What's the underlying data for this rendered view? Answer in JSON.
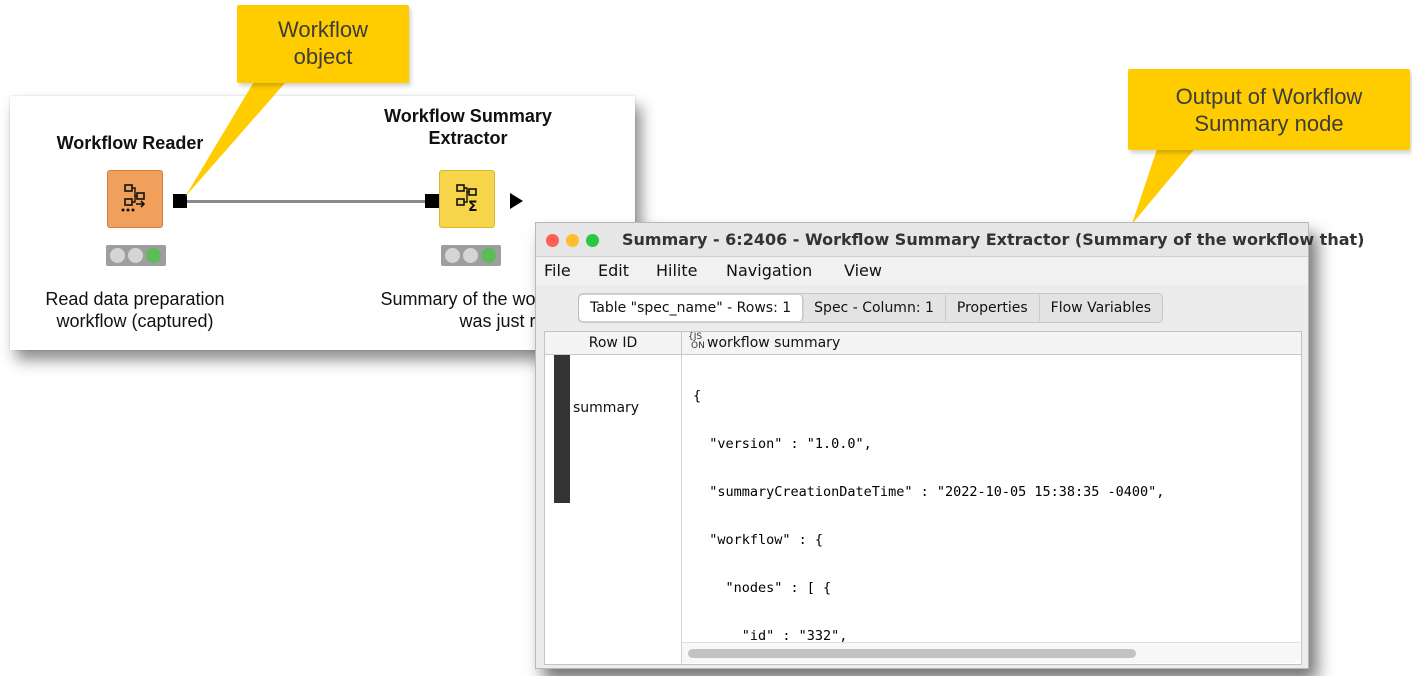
{
  "callouts": {
    "workflow_object": [
      "Workflow",
      "object"
    ],
    "output": [
      "Output of Workflow",
      "Summary node"
    ]
  },
  "workflow": {
    "reader": {
      "title": "Workflow Reader",
      "description": [
        "Read data preparation",
        "workflow (captured)"
      ]
    },
    "extractor": {
      "title": [
        "Workflow Summary",
        "Extractor"
      ],
      "description": [
        "Summary of the workfl",
        "was just read"
      ]
    }
  },
  "window": {
    "title": "Summary - 6:2406 - Workflow Summary Extractor (Summary of the workflow that)",
    "menu": [
      "File",
      "Edit",
      "Hilite",
      "Navigation",
      "View"
    ],
    "tabs": [
      {
        "label": "Table \"spec_name\" - Rows: 1",
        "active": true
      },
      {
        "label": "Spec - Column: 1",
        "active": false
      },
      {
        "label": "Properties",
        "active": false
      },
      {
        "label": "Flow Variables",
        "active": false
      }
    ],
    "table": {
      "headers": {
        "row_id": "Row ID",
        "json_badge": [
          "{JS",
          "ON"
        ],
        "column": "workflow summary"
      },
      "row_id": "summary",
      "json_lines": [
        "{",
        "  \"version\" : \"1.0.0\",",
        "  \"summaryCreationDateTime\" : \"2022-10-05 15:38:35 -0400\",",
        "  \"workflow\" : {",
        "    \"nodes\" : [ {",
        "      \"id\" : \"332\","
      ]
    }
  },
  "colors": {
    "callout": "#ffcc00",
    "reader_node": "#f0a05a",
    "extractor_node": "#f6d54b",
    "status_green": "#5cbc55"
  }
}
